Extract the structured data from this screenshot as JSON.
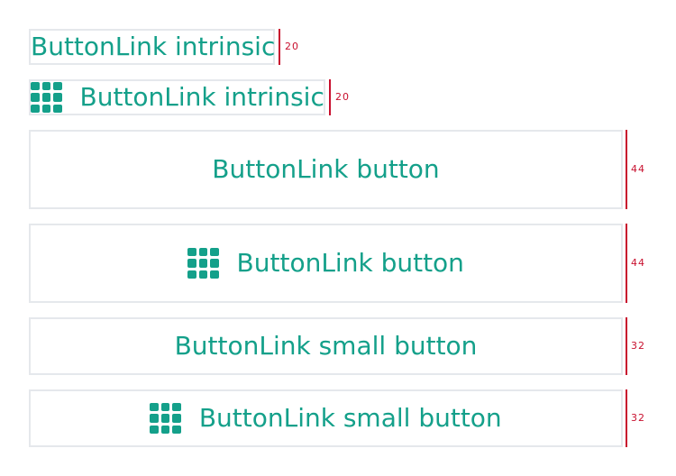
{
  "buttons": [
    {
      "label": "ButtonLink intrinsic",
      "has_icon": false,
      "height_label": "20"
    },
    {
      "label": "ButtonLink intrinsic",
      "has_icon": true,
      "icon": "grid-icon",
      "height_label": "20"
    },
    {
      "label": "ButtonLink button",
      "has_icon": false,
      "height_label": "44"
    },
    {
      "label": "ButtonLink button",
      "has_icon": true,
      "icon": "grid-icon",
      "height_label": "44"
    },
    {
      "label": "ButtonLink small button",
      "has_icon": false,
      "height_label": "32"
    },
    {
      "label": "ButtonLink small button",
      "has_icon": true,
      "icon": "grid-icon",
      "height_label": "32"
    }
  ],
  "colors": {
    "text": "#14a08a",
    "border": "#e5e8ec",
    "marker": "#c8102e"
  }
}
